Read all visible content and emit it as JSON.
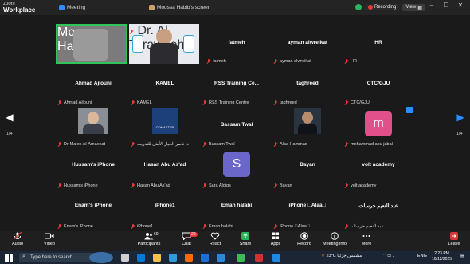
{
  "titlebar": {
    "brand_top": "zoom",
    "brand_bottom": "Workplace",
    "tab_meeting": "Meeting",
    "tab_screen": "Moussa Habib's screen",
    "recording": "Recording",
    "view": "View"
  },
  "tiles": {
    "t1": "Moussa Habib",
    "t2": "Dr. Al Tarawneh",
    "t3": "fatmeh",
    "t4": "ayman alwreikat",
    "t5": "HR",
    "t6": "Ahmad Ajlouni",
    "t7": "KAMEL",
    "t8_name": "RSS Training Ce...",
    "t8_label": "RSS Training Centre",
    "t9": "taghreed",
    "t10": "CTC/GJU",
    "t11": "Dr-Ma'en Al-Amaesat",
    "t12": "د. ناصر الخيار الأمثل للتدريب",
    "t13": "Bassam Twal",
    "t14": "Alaa Hammad",
    "t15": "mohammad abu jabal",
    "t16": "Hussam's iPhone",
    "t17": "Hasan Abu As'ad",
    "t18": "Sara Aldiqs",
    "t19": "Bayan",
    "t20": "volt academy",
    "t21": "Enam's iPhone",
    "t22": "iPhone1",
    "t23": "Eman halabi",
    "t24_name": "iPhone \u0000Alaa\u0000",
    "t24_label": "iPhone \u0000Alaa\u0000",
    "t25": "عبد النعيم حرسات",
    "avatar_s": "S",
    "avatar_m": "m",
    "comaster": "COMASTER"
  },
  "pagination": {
    "left": "1/4",
    "right": "1/4"
  },
  "toolbar": {
    "audio": "Audio",
    "video": "Video",
    "participants": "Participants",
    "participants_count": "60",
    "chat": "Chat",
    "chat_badge": "20",
    "react": "React",
    "share": "Share",
    "apps": "Apps",
    "record": "Record",
    "meeting_info": "Meeting info",
    "more": "More",
    "leave": "Leave"
  },
  "taskbar": {
    "search_placeholder": "Type here to search",
    "weather": "23°C  مشمس جزئيًا",
    "lang": "ENG",
    "time": "2:23 PM",
    "date": "10/12/2025"
  },
  "colors": {
    "accent_green": "#31c45a",
    "record_red": "#e23a3a",
    "avatar_s": "#6b66c9",
    "avatar_m": "#e0508a"
  }
}
